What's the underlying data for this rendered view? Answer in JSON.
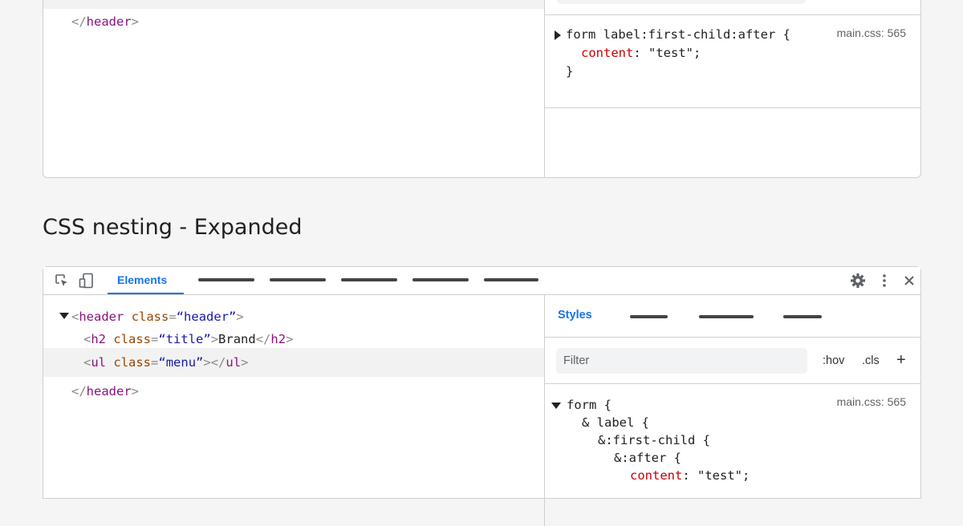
{
  "top": {
    "closing_tag": "header",
    "rule": {
      "selector": "form label:first-child:after {",
      "property": "content",
      "value": "\"test\";",
      "close": "}",
      "source": "main.css: 565"
    }
  },
  "heading": "CSS nesting - Expanded",
  "devtools": {
    "active_tab": "Elements",
    "styles_tab": "Styles",
    "filter_placeholder": "Filter",
    "hov_label": ":hov",
    "cls_label": ".cls",
    "add_label": "+",
    "icons": {
      "inspect": "inspect-cursor-icon",
      "device": "device-toggle-icon",
      "settings": "gear-icon",
      "more": "kebab-menu-icon",
      "close": "close-icon"
    }
  },
  "dom": {
    "header_tag": "header",
    "class_attr": "class",
    "header_class": "“header”",
    "h2_tag": "h2",
    "h2_class": "“title”",
    "h2_text": "Brand",
    "ul_tag": "ul",
    "ul_class": "“menu”"
  },
  "nested_rule": {
    "l1": "form {",
    "l2": "& label {",
    "l3": "&:first-child {",
    "l4": "&:after {",
    "property": "content",
    "value": "\"test\";",
    "source": "main.css: 565"
  }
}
